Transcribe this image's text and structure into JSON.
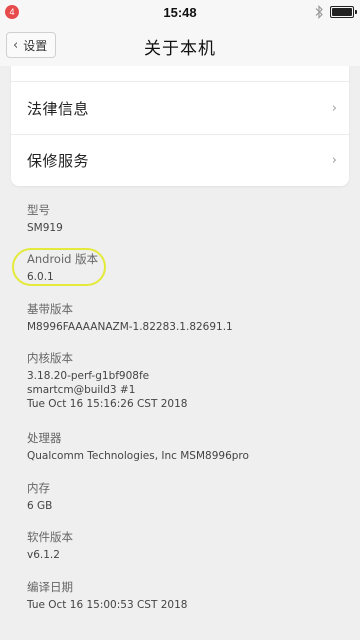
{
  "status_bar": {
    "notification_count": "4",
    "time": "15:48",
    "bluetooth_icon": "bluetooth-icon",
    "battery_level": 1.0
  },
  "header": {
    "back_label": "设置",
    "title": "关于本机"
  },
  "menu": [
    {
      "label": "法律信息"
    },
    {
      "label": "保修服务"
    }
  ],
  "info": [
    {
      "title": "型号",
      "values": [
        "SM919"
      ]
    },
    {
      "title": "Android 版本",
      "values": [
        "6.0.1"
      ]
    },
    {
      "title": "基带版本",
      "values": [
        "M8996FAAAANAZM-1.82283.1.82691.1"
      ]
    },
    {
      "title": "内核版本",
      "values": [
        "3.18.20-perf-g1bf908fe",
        "smartcm@build3 #1",
        "Tue Oct 16 15:16:26 CST 2018"
      ]
    },
    {
      "title": "处理器",
      "values": [
        "Qualcomm Technologies, Inc MSM8996pro"
      ]
    },
    {
      "title": "内存",
      "values": [
        "6 GB"
      ]
    },
    {
      "title": "软件版本",
      "values": [
        "v6.1.2"
      ]
    },
    {
      "title": "编译日期",
      "values": [
        "Tue Oct 16 15:00:53 CST 2018"
      ]
    }
  ],
  "colors": {
    "background": "#efefef",
    "highlight": "#e4ea3a",
    "badge": "#e84b4b"
  }
}
